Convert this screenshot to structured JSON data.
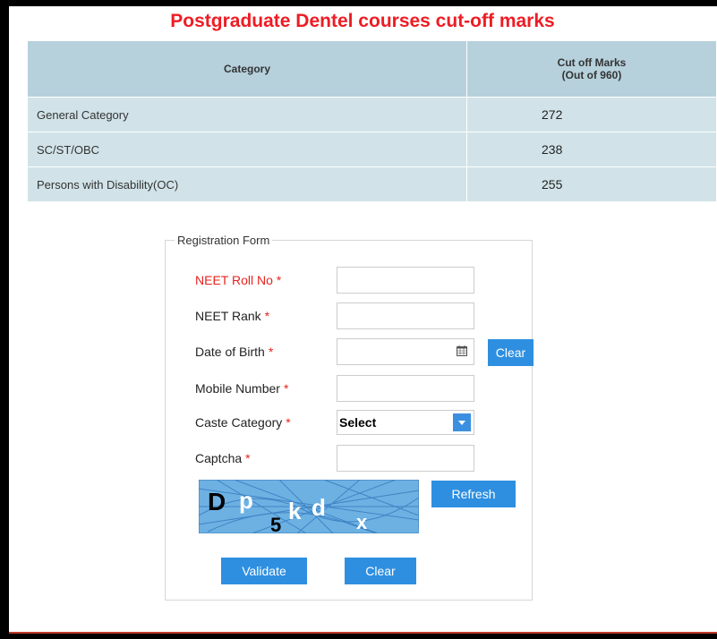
{
  "page": {
    "title": "Postgraduate Dentel courses cut-off marks"
  },
  "cutoff_table": {
    "header_category": "Category",
    "header_marks_line1": "Cut off Marks",
    "header_marks_line2": "(Out of 960)",
    "rows": [
      {
        "category": "General Category",
        "marks": "272"
      },
      {
        "category": "SC/ST/OBC",
        "marks": "238"
      },
      {
        "category": "Persons with Disability(OC)",
        "marks": "255"
      }
    ]
  },
  "form": {
    "legend": "Registration Form",
    "neet_roll_label": "NEET Roll No",
    "neet_rank_label": "NEET Rank",
    "dob_label": "Date of Birth",
    "mobile_label": "Mobile Number",
    "caste_label": "Caste Category",
    "captcha_label": "Captcha",
    "required_mark": "*",
    "caste_selected": "Select",
    "dob_clear_label": "Clear",
    "refresh_label": "Refresh",
    "validate_label": "Validate",
    "clear_label": "Clear",
    "captcha_text": "Dp5kdx"
  },
  "colors": {
    "title_red": "#ee1c24",
    "button_blue": "#2e8fe0",
    "table_header": "#b6d1dc",
    "table_row": "#d1e3e8"
  }
}
